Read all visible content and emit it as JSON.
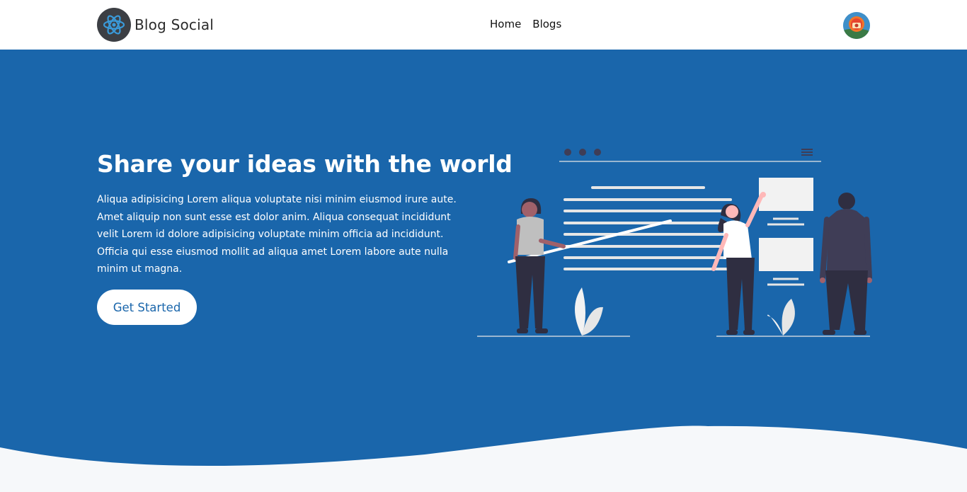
{
  "header": {
    "brand": "Blog Social",
    "nav": [
      {
        "label": "Home"
      },
      {
        "label": "Blogs"
      }
    ]
  },
  "hero": {
    "title": "Share your ideas with the world",
    "description": "Aliqua adipisicing Lorem aliqua voluptate nisi minim eiusmod irure aute. Amet aliquip non sunt esse est dolor anim. Aliqua consequat incididunt velit Lorem id dolore adipisicing voluptate minim officia ad incididunt. Officia qui esse eiusmod mollit ad aliqua amet Lorem labore aute nulla minim ut magna.",
    "cta_label": "Get Started"
  },
  "colors": {
    "primary": "#1a66ab",
    "background": "#f6f8fa",
    "header": "#ffffff"
  },
  "icons": {
    "brand": "atom-logo-icon",
    "avatar": "user-avatar"
  }
}
